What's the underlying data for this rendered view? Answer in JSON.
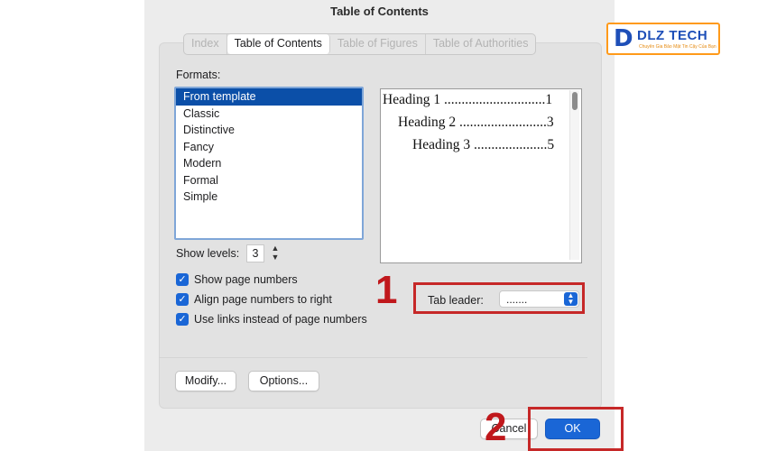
{
  "dialog": {
    "title": "Table of Contents",
    "tabs": [
      {
        "label": "Index",
        "active": false
      },
      {
        "label": "Table of Contents",
        "active": true
      },
      {
        "label": "Table of Figures",
        "active": false
      },
      {
        "label": "Table of Authorities",
        "active": false
      }
    ],
    "formats_label": "Formats:",
    "formats": [
      "From template",
      "Classic",
      "Distinctive",
      "Fancy",
      "Modern",
      "Formal",
      "Simple"
    ],
    "selected_format": "From template",
    "preview": {
      "rows": [
        {
          "text": "Heading 1 .............................1"
        },
        {
          "text": "Heading 2 .........................3"
        },
        {
          "text": "Heading 3 .....................5"
        }
      ]
    },
    "show_levels": {
      "label": "Show levels:",
      "value": "3"
    },
    "options": [
      {
        "label": "Show page numbers",
        "checked": true
      },
      {
        "label": "Align page numbers to right",
        "checked": true
      },
      {
        "label": "Use links instead of page numbers",
        "checked": true
      }
    ],
    "tab_leader": {
      "label": "Tab leader:",
      "value": "......."
    },
    "buttons": {
      "modify": "Modify...",
      "options": "Options...",
      "cancel": "Cancel",
      "ok": "OK"
    }
  },
  "annotations": {
    "marker_1": "1",
    "marker_2": "2",
    "highlight_color": "#c62828"
  },
  "watermark": {
    "logo_main": "DLZ TECH",
    "tagline": "Chuyên Gia Bảo Mật Tin Cậy Của Bạn",
    "accent_color": "#ff9a1a",
    "brand_color": "#1e4fb8"
  }
}
